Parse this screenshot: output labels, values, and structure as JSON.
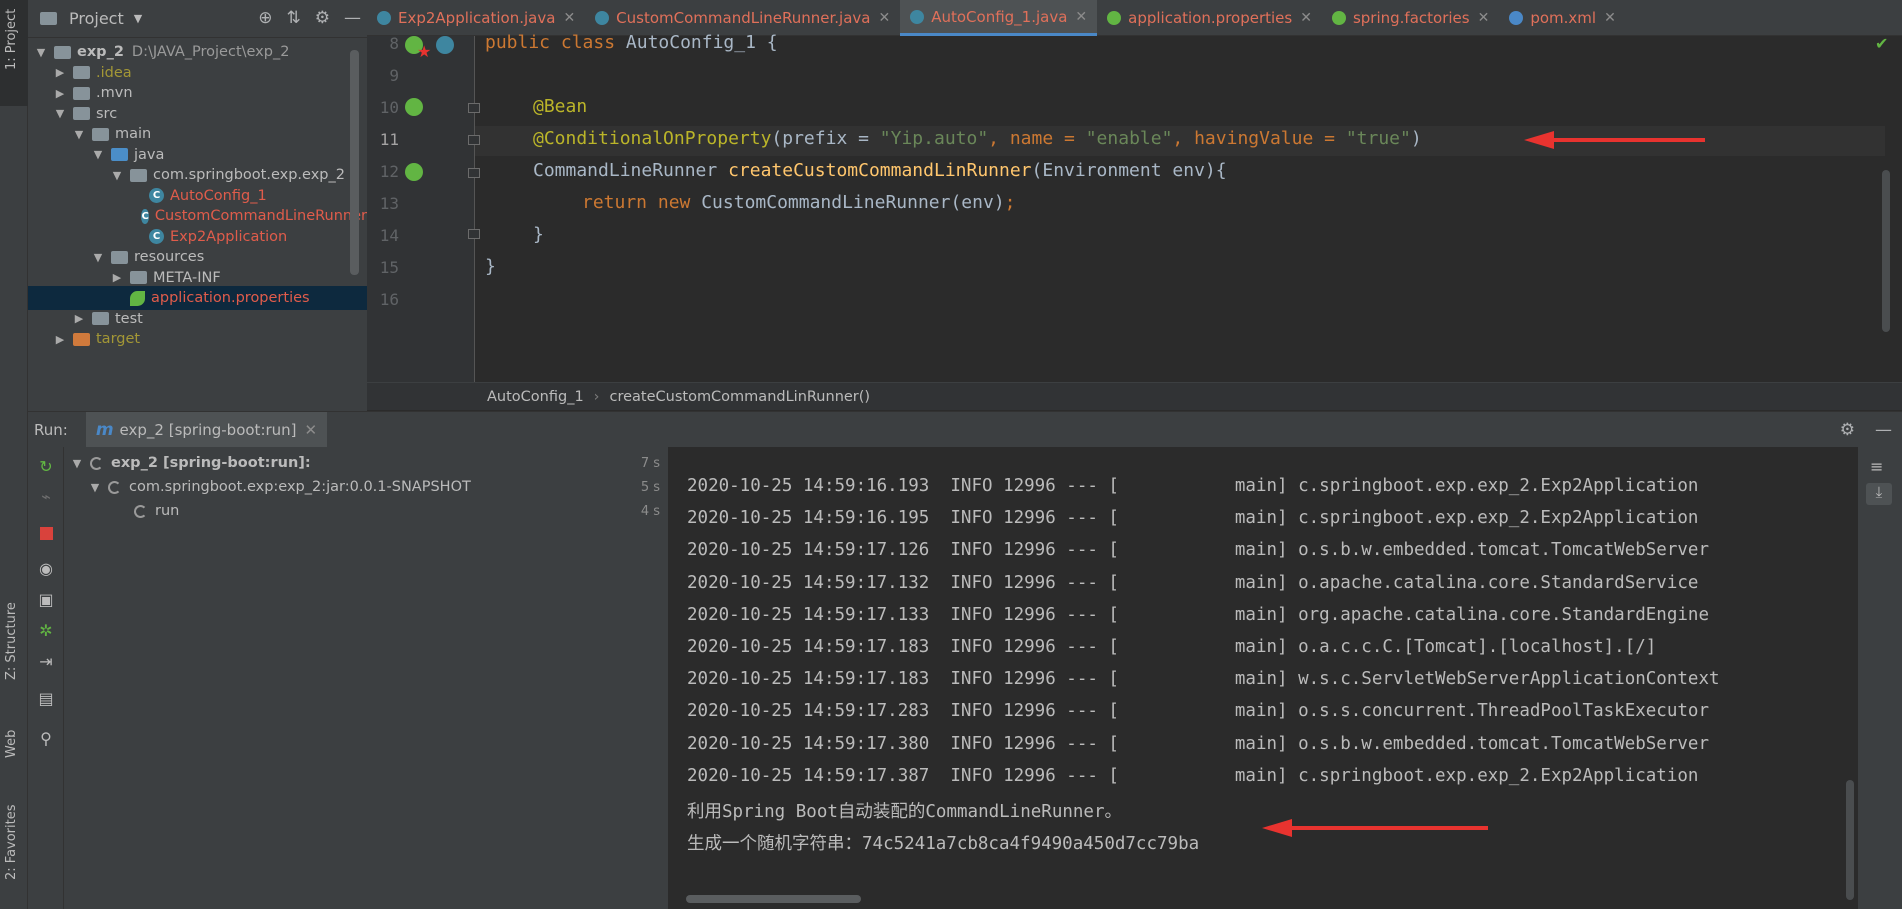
{
  "left_stripe": {
    "project_label": "1: Project",
    "structure_label": "Z: Structure",
    "web_label": "Web",
    "favorites_label": "2: Favorites"
  },
  "project_panel": {
    "title": "Project",
    "tree": [
      {
        "arrow": "▼",
        "name": "exp_2",
        "extra": "D:\\JAVA_Project\\exp_2",
        "kind": "folder",
        "color": "default",
        "bold": true
      },
      {
        "arrow": "▶",
        "name": ".idea",
        "kind": "folder",
        "color": "olive"
      },
      {
        "arrow": "▶",
        "name": ".mvn",
        "kind": "folder",
        "color": "default"
      },
      {
        "arrow": "▼",
        "name": "src",
        "kind": "folder",
        "color": "default"
      },
      {
        "arrow": "▼",
        "name": "main",
        "kind": "folder",
        "color": "default"
      },
      {
        "arrow": "▼",
        "name": "java",
        "kind": "folder-blue",
        "color": "default"
      },
      {
        "arrow": "▼",
        "name": "com.springboot.exp.exp_2",
        "kind": "package",
        "color": "default"
      },
      {
        "arrow": "",
        "name": "AutoConfig_1",
        "kind": "class",
        "color": "red"
      },
      {
        "arrow": "",
        "name": "CustomCommandLineRunner",
        "kind": "class",
        "color": "red"
      },
      {
        "arrow": "",
        "name": "Exp2Application",
        "kind": "class-boot",
        "color": "red"
      },
      {
        "arrow": "▼",
        "name": "resources",
        "kind": "folder",
        "color": "default"
      },
      {
        "arrow": "▶",
        "name": "META-INF",
        "kind": "folder",
        "color": "default"
      },
      {
        "arrow": "",
        "name": "application.properties",
        "kind": "leaf",
        "color": "red",
        "selected": true
      },
      {
        "arrow": "▶",
        "name": "test",
        "kind": "folder",
        "color": "default"
      },
      {
        "arrow": "▶",
        "name": "target",
        "kind": "folder-orange",
        "color": "olive"
      }
    ]
  },
  "tabs": [
    {
      "label": "Exp2Application.java",
      "icon": "spring-class-icon",
      "icon_color": "#3e86a0"
    },
    {
      "label": "CustomCommandLineRunner.java",
      "icon": "class-icon",
      "icon_color": "#3e86a0"
    },
    {
      "label": "AutoConfig_1.java",
      "icon": "class-icon",
      "icon_color": "#3e86a0",
      "active": true
    },
    {
      "label": "application.properties",
      "icon": "spring-leaf-icon",
      "icon_color": "#62b543"
    },
    {
      "label": "spring.factories",
      "icon": "spring-leaf-icon",
      "icon_color": "#62b543"
    },
    {
      "label": "pom.xml",
      "icon": "maven-icon",
      "icon_color": "#4a88c7"
    }
  ],
  "editor": {
    "line_numbers": [
      "8",
      "9",
      "10",
      "11",
      "12",
      "13",
      "14",
      "15",
      "16"
    ],
    "line8": {
      "kw1": "public class ",
      "name": "AutoConfig_1 {"
    },
    "line10": {
      "ann": "@Bean"
    },
    "line11": {
      "ann": "@ConditionalOnProperty",
      "p1": "(prefix = ",
      "s1": "\"Yip.auto\"",
      "p2": ", name = ",
      "s2": "\"enable\"",
      "p3": ", havingValue = ",
      "s3": "\"true\"",
      "p4": ")"
    },
    "line12": {
      "type": "CommandLineRunner ",
      "fn": "createCustomCommandLinRunner",
      "rest": "(Environment env){"
    },
    "line13": {
      "kw": "return new ",
      "rest": "CustomCommandLineRunner(env)",
      "semi": ";"
    },
    "line14": "}",
    "line15": "}"
  },
  "breadcrumb": {
    "class": "AutoConfig_1",
    "method": "createCustomCommandLinRunner()"
  },
  "run": {
    "label": "Run:",
    "tab": "exp_2 [spring-boot:run]",
    "tree": [
      {
        "name": "exp_2 [spring-boot:run]:",
        "time": "7 s"
      },
      {
        "name": "com.springboot.exp:exp_2:jar:0.0.1-SNAPSHOT",
        "time": "5 s"
      },
      {
        "name": "run",
        "time": "4 s"
      }
    ],
    "log_lines": [
      "2020-10-25 14:59:16.193  INFO 12996 --- [           main] c.springboot.exp.exp_2.Exp2Application",
      "2020-10-25 14:59:16.195  INFO 12996 --- [           main] c.springboot.exp.exp_2.Exp2Application",
      "2020-10-25 14:59:17.126  INFO 12996 --- [           main] o.s.b.w.embedded.tomcat.TomcatWebServer",
      "2020-10-25 14:59:17.132  INFO 12996 --- [           main] o.apache.catalina.core.StandardService",
      "2020-10-25 14:59:17.133  INFO 12996 --- [           main] org.apache.catalina.core.StandardEngine",
      "2020-10-25 14:59:17.183  INFO 12996 --- [           main] o.a.c.c.C.[Tomcat].[localhost].[/]",
      "2020-10-25 14:59:17.183  INFO 12996 --- [           main] w.s.c.ServletWebServerApplicationContext",
      "2020-10-25 14:59:17.283  INFO 12996 --- [           main] o.s.s.concurrent.ThreadPoolTaskExecutor",
      "2020-10-25 14:59:17.380  INFO 12996 --- [           main] o.s.b.w.embedded.tomcat.TomcatWebServer",
      "2020-10-25 14:59:17.387  INFO 12996 --- [           main] c.springboot.exp.exp_2.Exp2Application",
      "利用Spring Boot自动装配的CommandLineRunner。",
      "生成一个随机字符串：74c5241a7cb8ca4f9490a450d7cc79ba"
    ]
  },
  "colors": {
    "accent": "#4a88c7",
    "annotation_arrow": "#e8332f",
    "file_error": "#e05c4b"
  }
}
